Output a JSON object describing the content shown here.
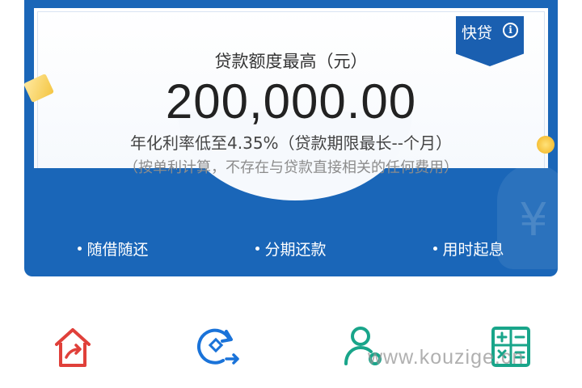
{
  "card": {
    "badge_label": "快贷",
    "limit_title": "贷款额度最高（元）",
    "amount": "200,000.00",
    "rate_text": "年化利率低至4.35%（贷款期限最长--个月）",
    "note_text": "（按单利计算，不存在与贷款直接相关的任何费用）",
    "background_glyph": "¥",
    "features": [
      "随借随还",
      "分期还款",
      "用时起息"
    ]
  },
  "quick_actions": [
    {
      "icon": "house-arrow-icon",
      "color": "#e0403a"
    },
    {
      "icon": "repay-cycle-icon",
      "color": "#1a73d9"
    },
    {
      "icon": "user-settings-icon",
      "color": "#19a58a"
    },
    {
      "icon": "calculator-icon",
      "color": "#19a58a"
    }
  ],
  "watermark": "www.kouzige.cn",
  "colors": {
    "card_blue": "#1a66b8",
    "badge_blue": "#1a5fb0",
    "amount_text": "#222222"
  }
}
